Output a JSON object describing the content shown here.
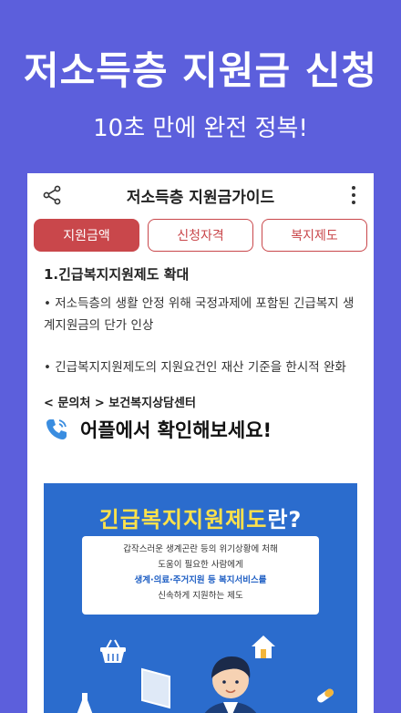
{
  "hero": {
    "title": "저소득층 지원금 신청",
    "subtitle": "10초 만에 완전 정복!"
  },
  "app": {
    "title": "저소득층 지원금가이드",
    "tabs": [
      {
        "label": "지원금액",
        "active": true
      },
      {
        "label": "신청자격",
        "active": false
      },
      {
        "label": "복지제도",
        "active": false
      }
    ]
  },
  "content": {
    "section_title": "1.긴급복지지원제도 확대",
    "paragraphs": [
      "• 저소득층의 생활 안정 위해 국정과제에 포함된 긴급복지 생계지원금의 단가 인상",
      "• 긴급복지지원제도의 지원요건인 재산 기준을 한시적 완화"
    ],
    "contact_label": "< 문의처 > 보건복지상담센터",
    "contact_text": "어플에서 확인해보세요!"
  },
  "banner": {
    "title": "긴급복지지원제도",
    "title_suffix": "란?",
    "card_line1": "갑작스러운 생계곤란 등의 위기상황에 처해",
    "card_line2": "도움이 필요한 사람에게",
    "card_highlight": "생계·의료·주거지원 등 복지서비스를",
    "card_line4": "신속하게 지원하는 제도"
  },
  "colors": {
    "background": "#5c5fdc",
    "accent": "#c9474b",
    "banner": "#2b6ccd",
    "banner_title": "#ffe24a"
  },
  "icons": [
    "share-icon",
    "more-vertical-icon",
    "phone-call-icon",
    "basket-icon",
    "house-icon",
    "pill-icon",
    "flask-icon"
  ]
}
